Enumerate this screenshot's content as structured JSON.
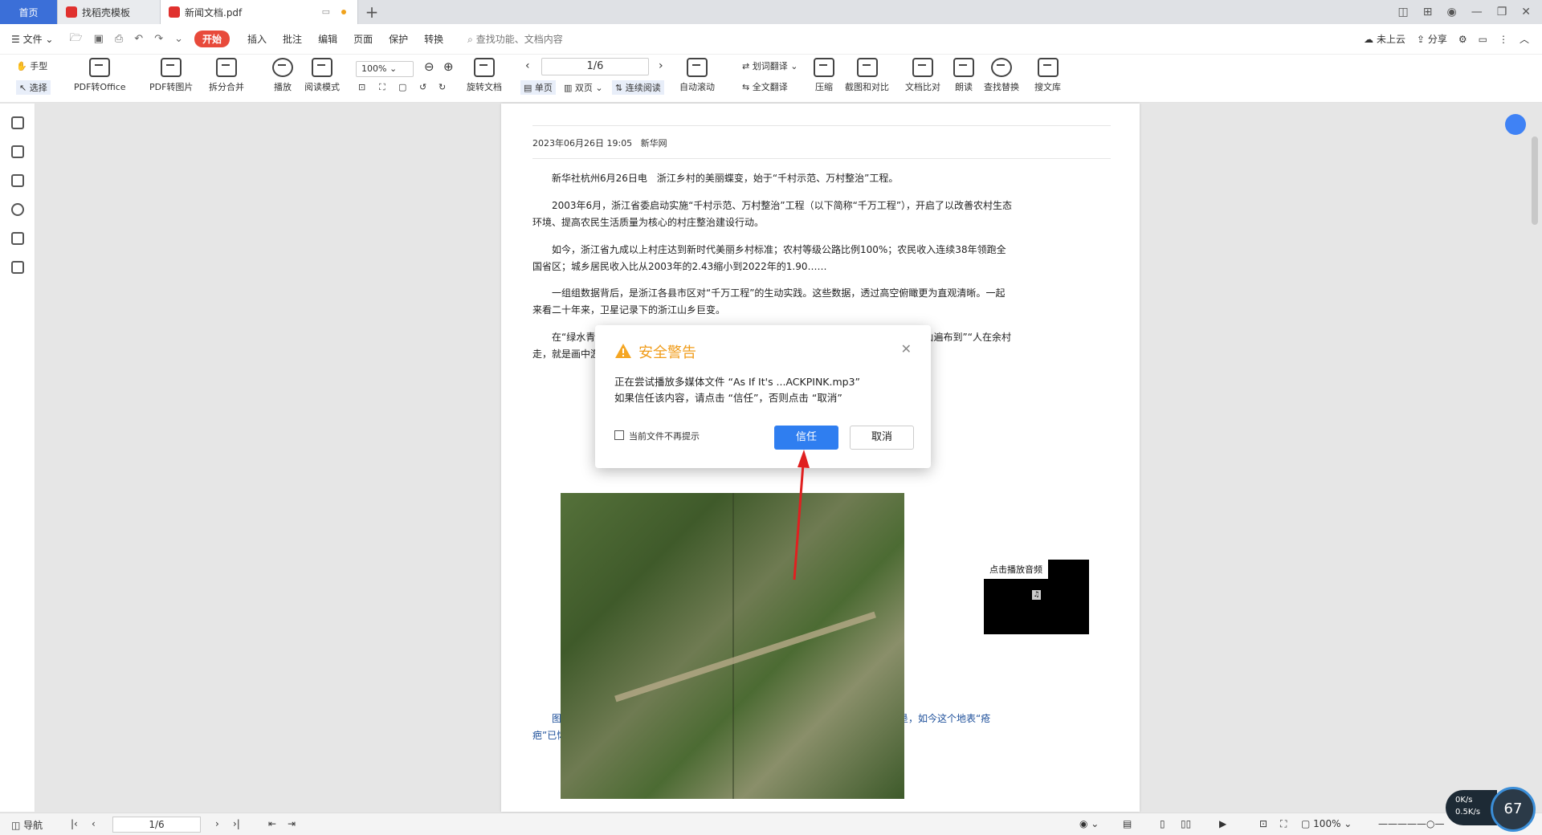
{
  "tabs": {
    "home": "首页",
    "template": "找稻壳模板",
    "active": "新闻文档.pdf",
    "new_tab": "+"
  },
  "menu": {
    "file": "文件",
    "start": "开始",
    "items": [
      "插入",
      "批注",
      "编辑",
      "页面",
      "保护",
      "转换"
    ],
    "search_placeholder": "查找功能、文档内容",
    "cloud": "未上云",
    "share": "分享"
  },
  "ribbon": {
    "hand": "手型",
    "select": "选择",
    "pdf_to_office": "PDF转Office",
    "pdf_to_image": "PDF转图片",
    "split_merge": "拆分合并",
    "play": "播放",
    "read_mode": "阅读模式",
    "zoom": "100%",
    "rotate": "旋转文档",
    "page_indicator": "1/6",
    "single_page": "单页",
    "double_page": "双页",
    "continuous": "连续阅读",
    "auto_scroll": "自动滚动",
    "word_translate": "划词翻译",
    "full_translate": "全文翻译",
    "compress": "压缩",
    "screenshot_compare": "截图和对比",
    "doc_compare": "文档比对",
    "read_aloud": "朗读",
    "find_replace": "查找替换",
    "search_library": "搜文库"
  },
  "document": {
    "meta_date": "2023年06月26日 19:05",
    "meta_source": "新华网",
    "paragraphs": [
      "新华社杭州6月26日电　浙江乡村的美丽蝶变，始于“千村示范、万村整治”工程。",
      "2003年6月，浙江省委启动实施“千村示范、万村整治”工程（以下简称“千万工程”），开启了以改善农村生态环境、提高农民生活质量为核心的村庄整治建设行动。",
      "如今，浙江省九成以上村庄达到新时代美丽乡村标准；农村等级公路比例100%；农民收入连续38年领跑全国省区；城乡居民收入比从2003年的2.43缩小到2022年的1.90……",
      "一组组数据背后，是浙江各县市区对“千万工程”的生动实践。这些数据，透过高空俯瞰更为直观清晰。一起来看二十年来，卫星记录下的浙江山乡巨变。",
      "在“绿水青山就是金山银山”理念发源地安吉县余村，从“靠山吃山”到“养山富山”，从“满山遍布到”“人在余村走，就是画中游”……从“工业飞鸟”到“生态田园”，"
    ],
    "caption": "图说：过去这里是余村废弃多年的老旧水泥厂房，厂房周围满目疮痍。通过土地复垦，如今这个地表“疮疤”已恢复良好的生态，当地准备将旧厂房改造成矿坑音乐谷。",
    "audio_label": "点击播放音频"
  },
  "dialog": {
    "title": "安全警告",
    "message_line1": "正在尝试播放多媒体文件 “As If It's ...ACKPINK.mp3”",
    "message_line2": "如果信任该内容，请点击 “信任”，否则点击 “取消”",
    "checkbox_label": "当前文件不再提示",
    "trust_button": "信任",
    "cancel_button": "取消"
  },
  "statusbar": {
    "nav": "导航",
    "page": "1/6",
    "zoom": "100%"
  },
  "net_widget": {
    "up": "0K/s",
    "down": "0.5K/s",
    "percent": "67"
  },
  "colors": {
    "accent": "#2f7ef0",
    "warning": "#f09c1a",
    "start_tab": "#e84a3b",
    "arrow": "#e02020"
  }
}
